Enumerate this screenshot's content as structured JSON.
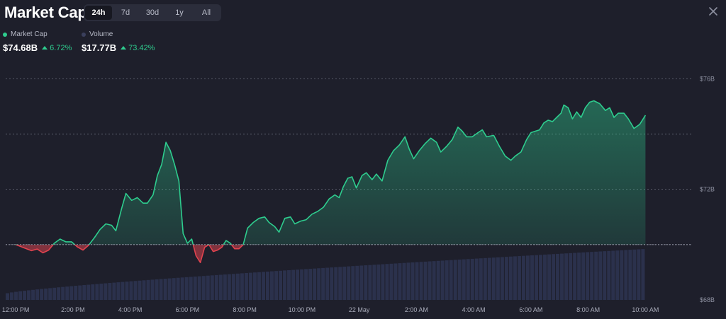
{
  "header": {
    "title": "Market Cap",
    "tabs": [
      "24h",
      "7d",
      "30d",
      "1y",
      "All"
    ],
    "active_tab": "24h"
  },
  "legend": {
    "market_cap": {
      "label": "Market Cap",
      "value": "$74.68B",
      "change": "6.72%",
      "color": "#2ecc8e"
    },
    "volume": {
      "label": "Volume",
      "value": "$17.77B",
      "change": "73.42%",
      "color": "#3a3f5c"
    }
  },
  "colors": {
    "up": "#2ecc8e",
    "down": "#e0434f",
    "background": "#1e1f2b",
    "volume": "#2c3350"
  },
  "chart_data": {
    "type": "area",
    "title": "Market Cap",
    "baseline": 70.0,
    "ylim": [
      68,
      76.8
    ],
    "y_ticks": [
      {
        "value": 76,
        "label": "$76B"
      },
      {
        "value": 72,
        "label": "$72B"
      },
      {
        "value": 68,
        "label": "$68B"
      }
    ],
    "y_gridlines": [
      76,
      74,
      72,
      70
    ],
    "x_ticks": [
      "12:00 PM",
      "2:00 PM",
      "4:00 PM",
      "6:00 PM",
      "8:00 PM",
      "10:00 PM",
      "22 May",
      "2:00 AM",
      "4:00 AM",
      "6:00 AM",
      "8:00 AM",
      "10:00 AM"
    ],
    "x_range_hours": [
      -0.35,
      23.6
    ],
    "series": [
      {
        "name": "Market Cap",
        "points": [
          [
            0.0,
            70.0
          ],
          [
            0.3,
            69.88
          ],
          [
            0.55,
            69.78
          ],
          [
            0.75,
            69.84
          ],
          [
            0.95,
            69.7
          ],
          [
            1.15,
            69.8
          ],
          [
            1.35,
            70.05
          ],
          [
            1.55,
            70.2
          ],
          [
            1.75,
            70.1
          ],
          [
            1.95,
            70.1
          ],
          [
            2.15,
            69.92
          ],
          [
            2.35,
            69.8
          ],
          [
            2.55,
            69.98
          ],
          [
            2.75,
            70.25
          ],
          [
            2.95,
            70.55
          ],
          [
            3.15,
            70.75
          ],
          [
            3.35,
            70.7
          ],
          [
            3.5,
            70.5
          ],
          [
            3.7,
            71.3
          ],
          [
            3.85,
            71.85
          ],
          [
            4.05,
            71.6
          ],
          [
            4.25,
            71.7
          ],
          [
            4.45,
            71.5
          ],
          [
            4.6,
            71.5
          ],
          [
            4.8,
            71.8
          ],
          [
            4.95,
            72.5
          ],
          [
            5.1,
            72.9
          ],
          [
            5.25,
            73.7
          ],
          [
            5.4,
            73.4
          ],
          [
            5.55,
            72.9
          ],
          [
            5.7,
            72.3
          ],
          [
            5.85,
            70.4
          ],
          [
            6.0,
            70.05
          ],
          [
            6.15,
            70.2
          ],
          [
            6.3,
            69.6
          ],
          [
            6.45,
            69.35
          ],
          [
            6.6,
            69.9
          ],
          [
            6.75,
            70.0
          ],
          [
            6.9,
            69.75
          ],
          [
            7.05,
            69.8
          ],
          [
            7.2,
            69.9
          ],
          [
            7.35,
            70.15
          ],
          [
            7.5,
            70.05
          ],
          [
            7.65,
            69.85
          ],
          [
            7.8,
            69.85
          ],
          [
            7.95,
            70.0
          ],
          [
            8.1,
            70.6
          ],
          [
            8.3,
            70.8
          ],
          [
            8.5,
            70.95
          ],
          [
            8.7,
            71.0
          ],
          [
            8.85,
            70.8
          ],
          [
            9.05,
            70.65
          ],
          [
            9.2,
            70.45
          ],
          [
            9.4,
            70.95
          ],
          [
            9.6,
            71.0
          ],
          [
            9.75,
            70.75
          ],
          [
            9.95,
            70.85
          ],
          [
            10.15,
            70.9
          ],
          [
            10.35,
            71.1
          ],
          [
            10.55,
            71.2
          ],
          [
            10.75,
            71.35
          ],
          [
            10.95,
            71.65
          ],
          [
            11.15,
            71.8
          ],
          [
            11.3,
            71.7
          ],
          [
            11.45,
            72.1
          ],
          [
            11.6,
            72.4
          ],
          [
            11.75,
            72.45
          ],
          [
            11.9,
            72.05
          ],
          [
            12.1,
            72.5
          ],
          [
            12.25,
            72.6
          ],
          [
            12.45,
            72.35
          ],
          [
            12.6,
            72.55
          ],
          [
            12.8,
            72.3
          ],
          [
            13.0,
            73.05
          ],
          [
            13.2,
            73.4
          ],
          [
            13.4,
            73.6
          ],
          [
            13.6,
            73.9
          ],
          [
            13.75,
            73.45
          ],
          [
            13.9,
            73.1
          ],
          [
            14.1,
            73.4
          ],
          [
            14.3,
            73.65
          ],
          [
            14.5,
            73.85
          ],
          [
            14.7,
            73.7
          ],
          [
            14.85,
            73.35
          ],
          [
            15.05,
            73.55
          ],
          [
            15.25,
            73.8
          ],
          [
            15.45,
            74.25
          ],
          [
            15.6,
            74.1
          ],
          [
            15.75,
            73.9
          ],
          [
            15.95,
            73.9
          ],
          [
            16.15,
            74.05
          ],
          [
            16.3,
            74.15
          ],
          [
            16.45,
            73.9
          ],
          [
            16.7,
            73.95
          ],
          [
            16.9,
            73.55
          ],
          [
            17.1,
            73.2
          ],
          [
            17.3,
            73.05
          ],
          [
            17.45,
            73.2
          ],
          [
            17.65,
            73.35
          ],
          [
            17.85,
            73.8
          ],
          [
            18.0,
            74.05
          ],
          [
            18.15,
            74.1
          ],
          [
            18.3,
            74.15
          ],
          [
            18.45,
            74.4
          ],
          [
            18.6,
            74.5
          ],
          [
            18.75,
            74.45
          ],
          [
            18.9,
            74.6
          ],
          [
            19.05,
            74.75
          ],
          [
            19.15,
            75.05
          ],
          [
            19.3,
            74.95
          ],
          [
            19.45,
            74.55
          ],
          [
            19.6,
            74.8
          ],
          [
            19.75,
            74.6
          ],
          [
            19.9,
            74.95
          ],
          [
            20.05,
            75.15
          ],
          [
            20.2,
            75.2
          ],
          [
            20.4,
            75.1
          ],
          [
            20.6,
            74.85
          ],
          [
            20.75,
            74.95
          ],
          [
            20.9,
            74.6
          ],
          [
            21.05,
            74.75
          ],
          [
            21.25,
            74.75
          ],
          [
            21.4,
            74.55
          ],
          [
            21.6,
            74.2
          ],
          [
            21.8,
            74.35
          ],
          [
            22.0,
            74.68
          ]
        ]
      },
      {
        "name": "Volume",
        "volume_level_start": 0.05,
        "volume_level_end": 0.38,
        "bar_count": 150
      }
    ]
  }
}
